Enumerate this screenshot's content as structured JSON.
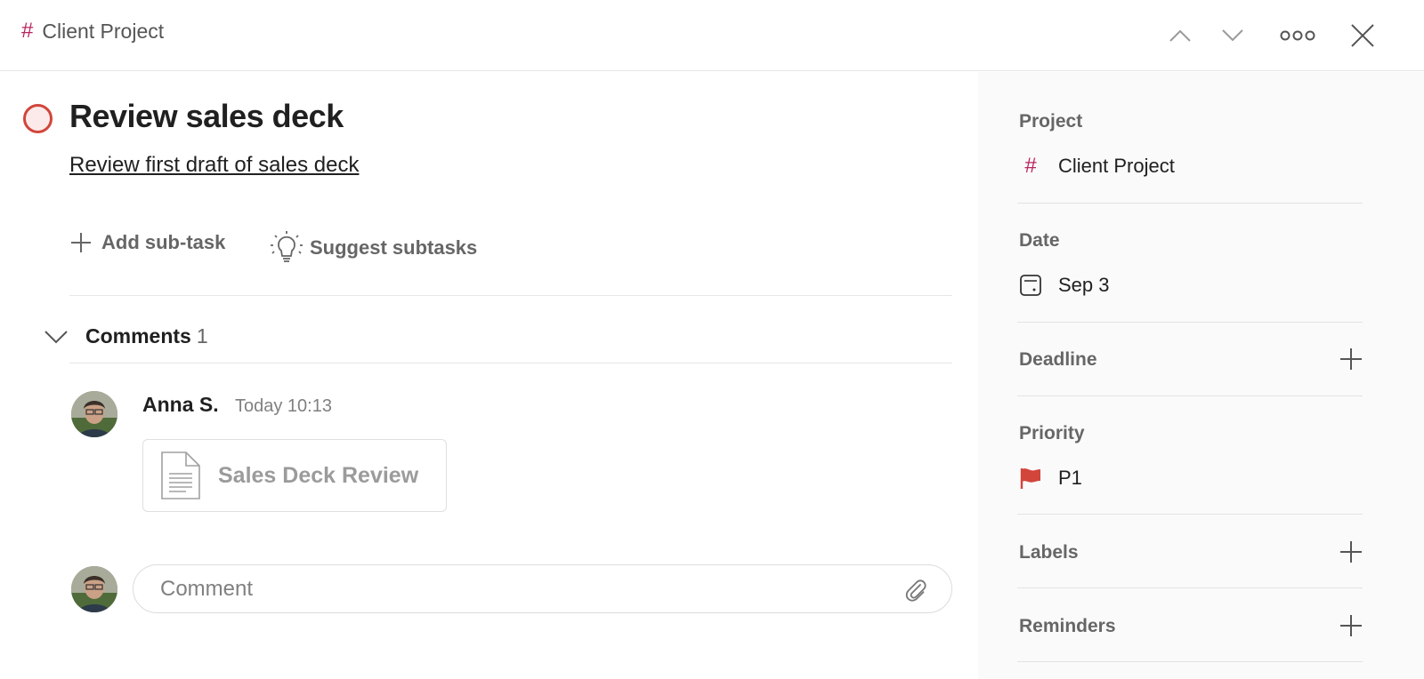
{
  "header": {
    "breadcrumb_project": "Client Project",
    "icons": [
      "hash-icon",
      "chevron-up-icon",
      "chevron-down-icon",
      "more-icon",
      "close-icon"
    ]
  },
  "task": {
    "title": "Review sales deck",
    "description": "Review first draft of sales deck",
    "add_subtask_label": "Add sub-task",
    "suggest_subtasks_label": "Suggest subtasks"
  },
  "comments": {
    "title": "Comments",
    "count": "1",
    "items": [
      {
        "author": "Anna S.",
        "time": "Today 10:13",
        "attachment_name": "Sales Deck Review"
      }
    ],
    "input_placeholder": "Comment"
  },
  "sidebar": {
    "project_label": "Project",
    "project_value": "Client Project",
    "date_label": "Date",
    "date_value": "Sep 3",
    "deadline_label": "Deadline",
    "priority_label": "Priority",
    "priority_value": "P1",
    "labels_label": "Labels",
    "reminders_label": "Reminders"
  },
  "colors": {
    "project_hash": "#b8255f",
    "priority_flag": "#d1453b",
    "checkbox_ring": "#d1453b",
    "sidebar_bg": "#fafafa"
  }
}
